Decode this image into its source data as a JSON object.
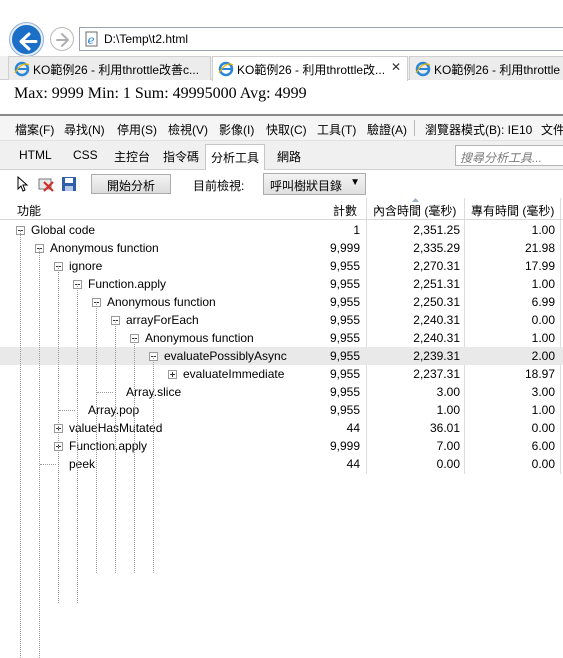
{
  "browser": {
    "url": "D:\\Temp\\t2.html",
    "tabs": [
      {
        "title": "KO範例26 - 利用throttle改善c...",
        "active": false
      },
      {
        "title": "KO範例26 - 利用throttle改...",
        "active": true,
        "close": "✕"
      },
      {
        "title": "KO範例26 - 利用throttle",
        "active": false
      }
    ]
  },
  "page": {
    "text": "Max: 9999 Min: 1 Sum: 49995000 Avg: 4999"
  },
  "devtools": {
    "menu": [
      "檔案(F)",
      "尋找(N)",
      "停用(S)",
      "檢視(V)",
      "影像(I)",
      "快取(C)",
      "工具(T)",
      "驗證(A)",
      "瀏覽器模式(B): IE10",
      "文件"
    ],
    "tabs": [
      "HTML",
      "CSS",
      "主控台",
      "指令碼",
      "分析工具",
      "網路"
    ],
    "active_tab": "分析工具",
    "search_placeholder": "搜尋分析工具...",
    "toolbar": {
      "start_label": "開始分析",
      "view_label": "目前檢視:",
      "view_value": "呼叫樹狀目錄"
    },
    "columns": [
      "功能",
      "計數",
      "內含時間 (毫秒)",
      "專有時間 (毫秒)"
    ],
    "rows": [
      {
        "name": "Global code",
        "count": "1",
        "inclusive": "2,351.25",
        "exclusive": "1.00"
      },
      {
        "name": "Anonymous function",
        "count": "9,999",
        "inclusive": "2,335.29",
        "exclusive": "21.98"
      },
      {
        "name": "ignore",
        "count": "9,955",
        "inclusive": "2,270.31",
        "exclusive": "17.99"
      },
      {
        "name": "Function.apply",
        "count": "9,955",
        "inclusive": "2,251.31",
        "exclusive": "1.00"
      },
      {
        "name": "Anonymous function",
        "count": "9,955",
        "inclusive": "2,250.31",
        "exclusive": "6.99"
      },
      {
        "name": "arrayForEach",
        "count": "9,955",
        "inclusive": "2,240.31",
        "exclusive": "0.00"
      },
      {
        "name": "Anonymous function",
        "count": "9,955",
        "inclusive": "2,240.31",
        "exclusive": "1.00"
      },
      {
        "name": "evaluatePossiblyAsync",
        "count": "9,955",
        "inclusive": "2,239.31",
        "exclusive": "2.00"
      },
      {
        "name": "evaluateImmediate",
        "count": "9,955",
        "inclusive": "2,237.31",
        "exclusive": "18.97"
      },
      {
        "name": "Array.slice",
        "count": "9,955",
        "inclusive": "3.00",
        "exclusive": "3.00"
      },
      {
        "name": "Array.pop",
        "count": "9,955",
        "inclusive": "1.00",
        "exclusive": "1.00"
      },
      {
        "name": "valueHasMutated",
        "count": "44",
        "inclusive": "36.01",
        "exclusive": "0.00"
      },
      {
        "name": "Function.apply",
        "count": "9,999",
        "inclusive": "7.00",
        "exclusive": "6.00"
      },
      {
        "name": "peek",
        "count": "44",
        "inclusive": "0.00",
        "exclusive": "0.00"
      }
    ]
  },
  "colors": {
    "back_button": "#1c6fc7",
    "ie_icon": "#2a86d8",
    "selected_row": "#e9e9e9"
  }
}
